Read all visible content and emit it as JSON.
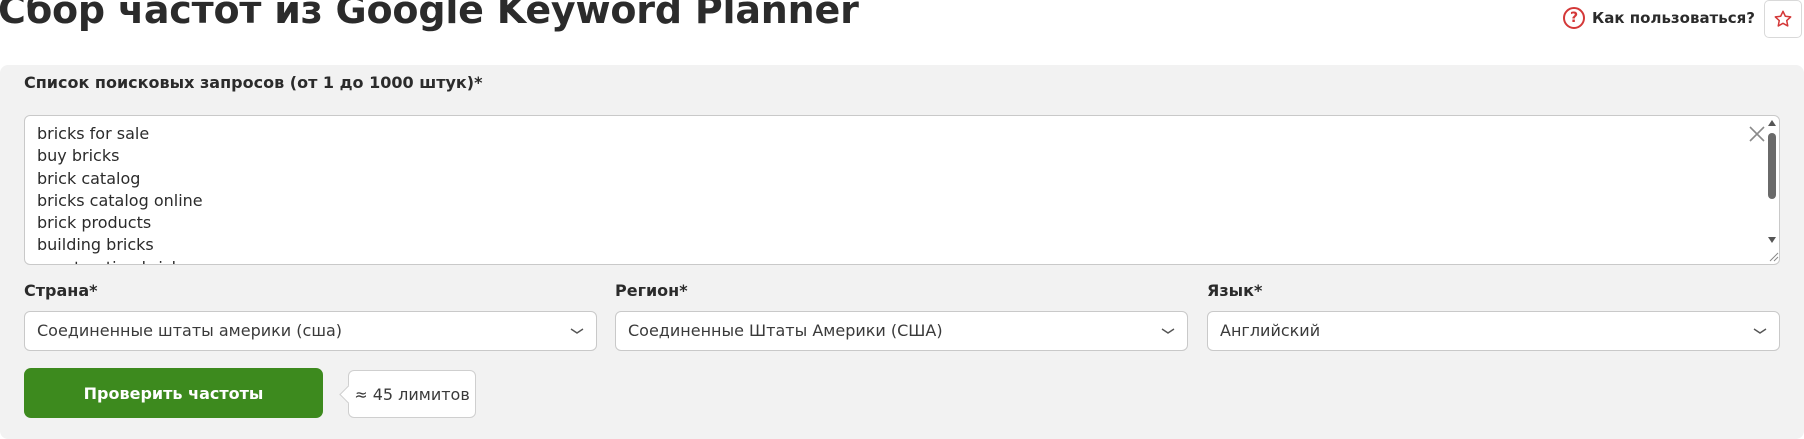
{
  "header": {
    "title": "Сбор частот из Google Keyword Planner",
    "help_label": "Как пользоваться?",
    "help_icon": "question-circle-icon",
    "favorite_icon": "star-outline-icon"
  },
  "form": {
    "queries_label": "Список поисковых запросов (от 1 до 1000 штук)*",
    "queries_value": "bricks for sale\nbuy bricks\nbrick catalog\nbricks catalog online\nbrick products\nbuilding bricks\nconstruction bricks",
    "country": {
      "label": "Страна*",
      "value": "Соединенные штаты америки (сша)"
    },
    "region": {
      "label": "Регион*",
      "value": "Соединенные Штаты Америки (США)"
    },
    "language": {
      "label": "Язык*",
      "value": "Английский"
    },
    "submit_label": "Проверить частоты",
    "limits_text": "≈ 45 лимитов"
  },
  "colors": {
    "accent_green": "#3d8a1e",
    "help_red": "#d43838",
    "panel_bg": "#f2f2f2"
  }
}
